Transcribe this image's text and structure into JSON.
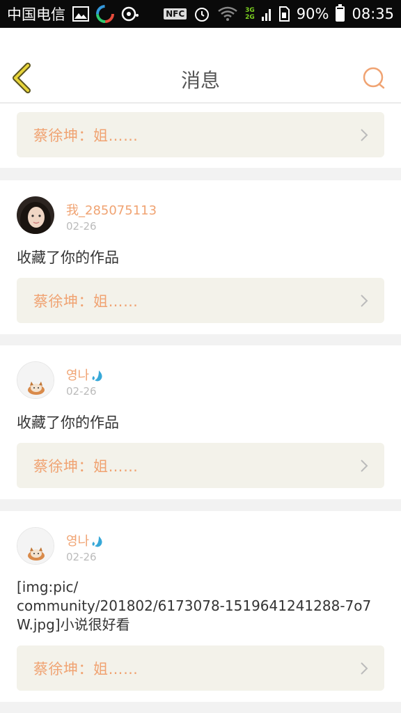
{
  "status_bar": {
    "carrier": "中国电信",
    "nfc": "NFC",
    "network_top": "3G",
    "network_bottom": "2G",
    "battery": "90%",
    "battery_level": 0.9,
    "time": "08:35"
  },
  "header": {
    "title": "消息",
    "back_icon": "chevron-left-icon",
    "search_icon": "search-icon",
    "accent_color": "#f0a372"
  },
  "messages": [
    {
      "quote": "蔡徐坤：姐……"
    },
    {
      "username": "我_285075113",
      "date": "02-26",
      "text": "收藏了你的作品",
      "quote": "蔡徐坤：姐……"
    },
    {
      "username": "영나",
      "date": "02-26",
      "text": "收藏了你的作品",
      "quote": "蔡徐坤：姐……"
    },
    {
      "username": "영나",
      "date": "02-26",
      "text_line1": "[img:pic/",
      "text_line2": "community/201802/6173078-1519641241288-7o7",
      "text_line3": "W.jpg]小说很好看",
      "quote": "蔡徐坤：姐……"
    }
  ]
}
